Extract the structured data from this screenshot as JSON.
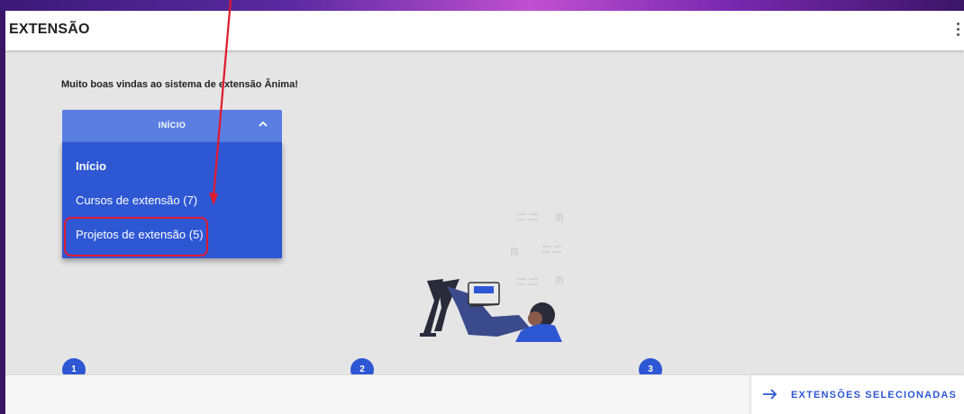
{
  "app": {
    "title": "EXTENSÃO",
    "menu_icon": "kebab-menu-icon"
  },
  "main": {
    "welcome": "Muito boas vindas ao sistema de extensão Ânima!"
  },
  "dropdown": {
    "header_label": "INÍCIO",
    "header_icon": "chevron-up-icon",
    "items": [
      {
        "label": "Início",
        "active": true
      },
      {
        "label": "Cursos de extensão (7)",
        "active": false
      },
      {
        "label": "Projetos de extensão (5)",
        "active": false,
        "highlighted": true
      }
    ]
  },
  "steps": [
    "1",
    "2",
    "3"
  ],
  "footer": {
    "button_label": "EXTENSÕES SELECIONADAS",
    "button_icon": "arrow-right-icon"
  },
  "colors": {
    "primary": "#2e57d4",
    "header": "#5b7ee2",
    "annotation": "#e01a2a",
    "background": "#e5e5e5"
  }
}
